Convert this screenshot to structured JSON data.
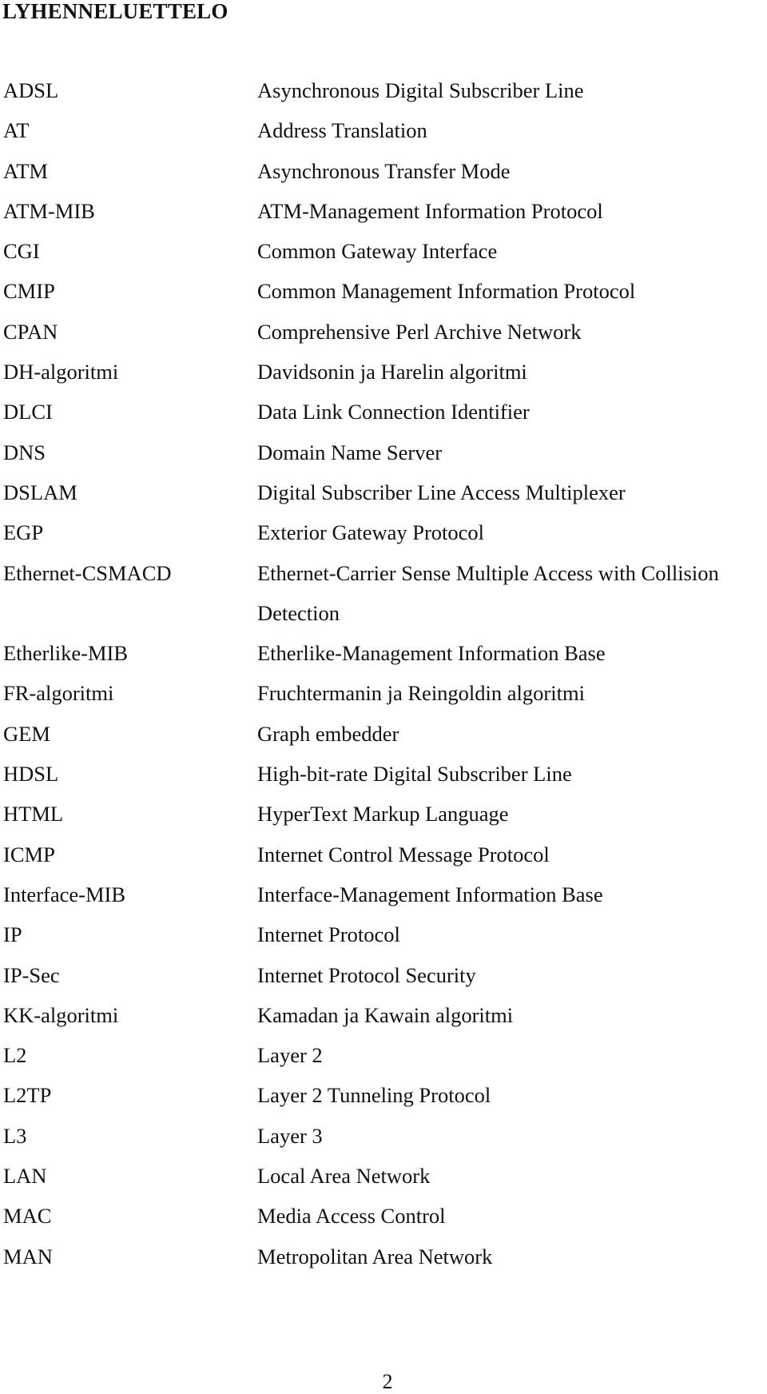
{
  "document": {
    "title": "LYHENNELUETTELO",
    "page_number": "2",
    "entries": [
      {
        "abbr": "ADSL",
        "desc": "Asynchronous Digital Subscriber Line"
      },
      {
        "abbr": "AT",
        "desc": "Address Translation"
      },
      {
        "abbr": "ATM",
        "desc": "Asynchronous Transfer Mode"
      },
      {
        "abbr": "ATM-MIB",
        "desc": "ATM-Management Information Protocol"
      },
      {
        "abbr": "CGI",
        "desc": "Common Gateway Interface"
      },
      {
        "abbr": "CMIP",
        "desc": "Common Management Information Protocol"
      },
      {
        "abbr": "CPAN",
        "desc": "Comprehensive Perl Archive Network"
      },
      {
        "abbr": "DH-algoritmi",
        "desc": "Davidsonin ja Harelin algoritmi"
      },
      {
        "abbr": "DLCI",
        "desc": "Data Link Connection Identifier"
      },
      {
        "abbr": "DNS",
        "desc": "Domain Name Server"
      },
      {
        "abbr": "DSLAM",
        "desc": "Digital Subscriber Line Access Multiplexer"
      },
      {
        "abbr": "EGP",
        "desc": "Exterior Gateway Protocol"
      },
      {
        "abbr": "Ethernet-CSMACD",
        "desc": "Ethernet-Carrier Sense Multiple Access with Collision"
      },
      {
        "abbr": "",
        "desc": "Detection"
      },
      {
        "abbr": "Etherlike-MIB",
        "desc": "Etherlike-Management Information Base"
      },
      {
        "abbr": "FR-algoritmi",
        "desc": "Fruchtermanin ja Reingoldin algoritmi"
      },
      {
        "abbr": "GEM",
        "desc": "Graph embedder"
      },
      {
        "abbr": "HDSL",
        "desc": "High-bit-rate Digital Subscriber Line"
      },
      {
        "abbr": "HTML",
        "desc": "HyperText Markup Language"
      },
      {
        "abbr": "ICMP",
        "desc": "Internet Control Message Protocol"
      },
      {
        "abbr": "Interface-MIB",
        "desc": "Interface-Management Information Base"
      },
      {
        "abbr": "IP",
        "desc": "Internet Protocol"
      },
      {
        "abbr": "IP-Sec",
        "desc": "Internet Protocol Security"
      },
      {
        "abbr": "KK-algoritmi",
        "desc": "Kamadan ja Kawain algoritmi"
      },
      {
        "abbr": "L2",
        "desc": "Layer 2"
      },
      {
        "abbr": "L2TP",
        "desc": "Layer 2 Tunneling Protocol"
      },
      {
        "abbr": "L3",
        "desc": "Layer 3"
      },
      {
        "abbr": "LAN",
        "desc": "Local Area Network"
      },
      {
        "abbr": "MAC",
        "desc": "Media Access Control"
      },
      {
        "abbr": "MAN",
        "desc": "Metropolitan Area Network"
      }
    ]
  }
}
